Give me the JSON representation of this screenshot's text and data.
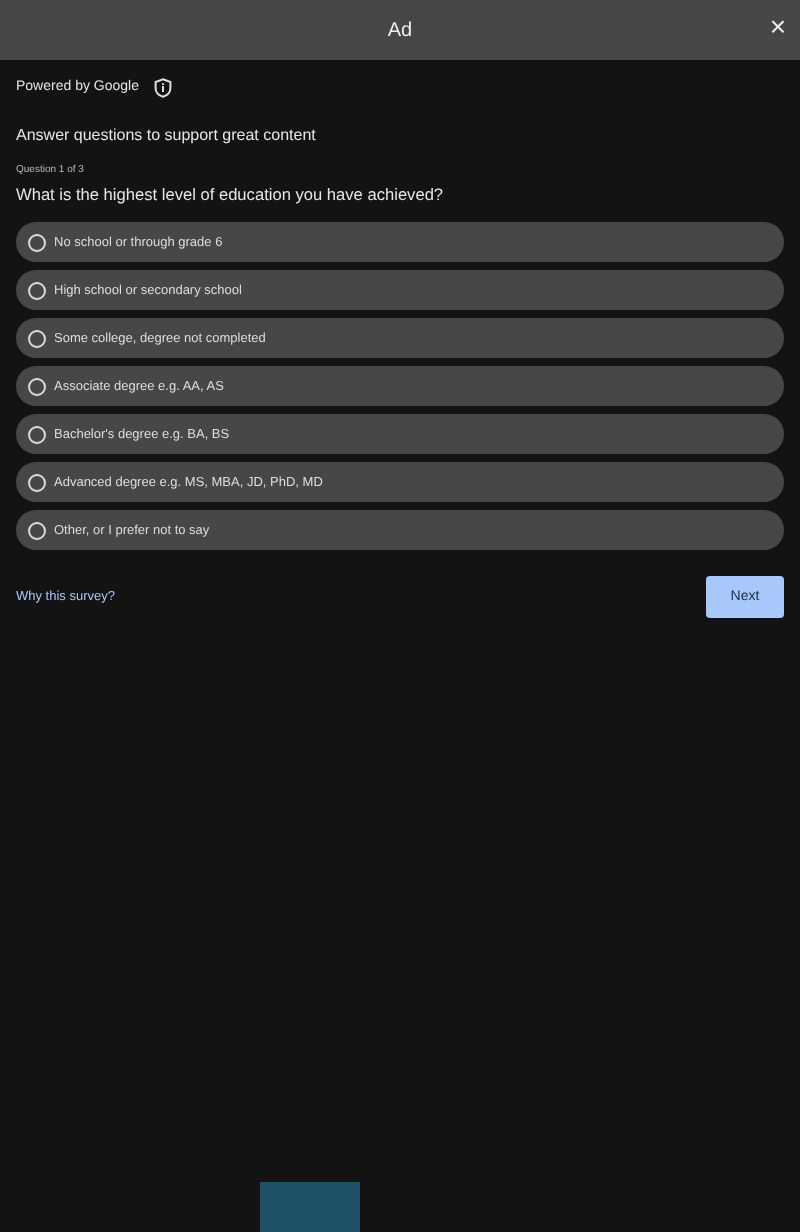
{
  "window": {
    "title": "Ad",
    "close": "×"
  },
  "attribution": "Powered by Google",
  "heading": "Answer questions to support great content",
  "counter": "Question 1 of 3",
  "question": "What is the highest level of education you have achieved?",
  "options": [
    {
      "label": "No school or through grade 6",
      "selected": false
    },
    {
      "label": "High school or secondary school",
      "selected": false
    },
    {
      "label": "Some college, degree not completed",
      "selected": false
    },
    {
      "label": "Associate degree e.g. AA, AS",
      "selected": false
    },
    {
      "label": "Bachelor's degree e.g. BA, BS",
      "selected": false
    },
    {
      "label": "Advanced degree e.g. MS, MBA, JD, PhD, MD",
      "selected": false
    },
    {
      "label": "Other, or I prefer not to say",
      "selected": false
    }
  ],
  "link": "Why this survey?",
  "next": "Next"
}
